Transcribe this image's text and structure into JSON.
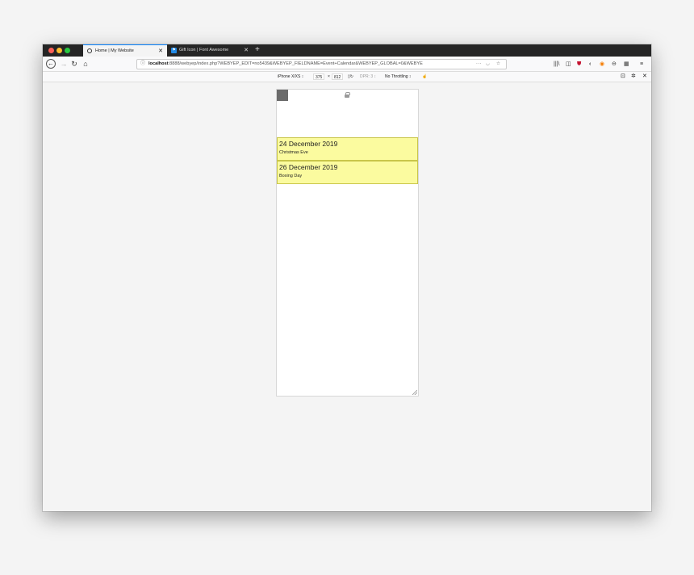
{
  "browser": {
    "tabs": [
      {
        "title": "Home | My Website",
        "icon": "globe-icon"
      },
      {
        "title": "Gift Icon | Font Awesome",
        "icon": "font-awesome-icon"
      }
    ],
    "url": {
      "host": "localhost",
      "rest": ":8888/webyep/index.php?WEBYEP_EDIT=no5439&WEBYEP_FIELDNAME=Event+Calendar&WEBYEP_GLOBAL=0&WEBYE",
      "more": "···"
    }
  },
  "responsive_toolbar": {
    "device": "iPhone X/XS ↕",
    "width": "375",
    "times": "×",
    "height": "812",
    "dpr": "DPR: 3 ↕",
    "throttling": "No Throttling ↕"
  },
  "events": [
    {
      "date": "24 December 2019",
      "name": "Christmas Eve"
    },
    {
      "date": "26 December 2019",
      "name": "Boxing Day"
    }
  ]
}
